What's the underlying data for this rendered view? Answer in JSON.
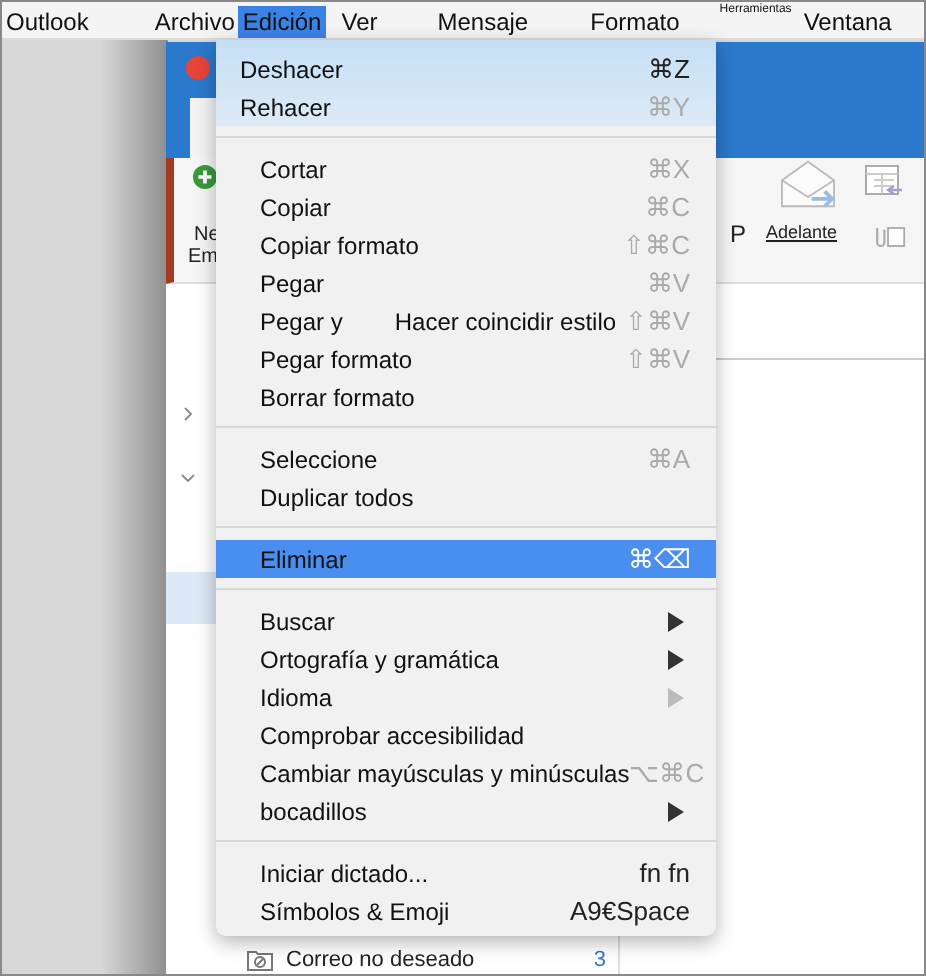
{
  "menu_bar": [
    {
      "label": "Outlook",
      "selected": false
    },
    {
      "label": "Archivo",
      "selected": false
    },
    {
      "label": "Edición",
      "selected": true
    },
    {
      "label": "Ver",
      "selected": false
    },
    {
      "label": "Mensaje",
      "selected": false
    },
    {
      "label": "Formato",
      "selected": false
    },
    {
      "label": "Herramientas",
      "selected": false
    },
    {
      "label": "Ventana",
      "selected": false
    }
  ],
  "window": {
    "toolbar": {
      "new_label_line_1": "Ne",
      "new_label_line_2": "Em",
      "reply_label": "P",
      "forward_label": "Adelante"
    },
    "folder": {
      "name": "Correo no deseado",
      "count": "3"
    }
  },
  "edit_menu": {
    "sections": [
      {
        "items": [
          {
            "label": "Deshacer",
            "shortcut": "⌘Z",
            "shortcut_dim": false,
            "submenu": false,
            "selected": false
          },
          {
            "label": "Rehacer",
            "shortcut": "⌘Y",
            "shortcut_dim": true,
            "submenu": false,
            "selected": false
          }
        ]
      },
      {
        "items": [
          {
            "label": "Cortar",
            "shortcut": "⌘X",
            "shortcut_dim": true,
            "submenu": false,
            "selected": false
          },
          {
            "label": "Copiar",
            "shortcut": "⌘C",
            "shortcut_dim": true,
            "submenu": false,
            "selected": false
          },
          {
            "label": "Copiar formato",
            "shortcut": "⇧⌘C",
            "shortcut_dim": true,
            "submenu": false,
            "selected": false
          },
          {
            "label": "Pegar",
            "shortcut": "⌘V",
            "shortcut_dim": true,
            "submenu": false,
            "selected": false
          },
          {
            "label": "Pegar y",
            "label_2": "Hacer coincidir estilo",
            "shortcut": "⇧⌘V",
            "shortcut_dim": true,
            "submenu": false,
            "selected": false
          },
          {
            "label": "Pegar formato",
            "shortcut": "⇧⌘V",
            "shortcut_dim": true,
            "submenu": false,
            "selected": false
          },
          {
            "label": "Borrar formato",
            "submenu": false,
            "selected": false
          }
        ]
      },
      {
        "items": [
          {
            "label": "Seleccione",
            "shortcut": "⌘A",
            "shortcut_dim": true,
            "submenu": false,
            "selected": false
          },
          {
            "label": "Duplicar todos",
            "submenu": false,
            "selected": false
          }
        ]
      },
      {
        "items": [
          {
            "label": "Eliminar",
            "shortcut": "⌘⌫",
            "shortcut_dim": false,
            "submenu": false,
            "selected": true
          }
        ]
      },
      {
        "items": [
          {
            "label": "Buscar",
            "submenu": true,
            "submenu_enabled": true,
            "selected": false
          },
          {
            "label": "Ortografía y gramática",
            "submenu": true,
            "submenu_enabled": true,
            "selected": false
          },
          {
            "label": "Idioma",
            "submenu": true,
            "submenu_enabled": false,
            "selected": false
          },
          {
            "label": "Comprobar accesibilidad",
            "submenu": false,
            "selected": false
          },
          {
            "label": "Cambiar mayúsculas y minúsculas",
            "shortcut": "⌥⌘C",
            "shortcut_dim": true,
            "submenu": false,
            "selected": false
          },
          {
            "label": "bocadillos",
            "submenu": true,
            "submenu_enabled": true,
            "selected": false
          }
        ]
      },
      {
        "items": [
          {
            "label": "Iniciar dictado...",
            "shortcut": "fn fn",
            "shortcut_dim": false,
            "submenu": false,
            "selected": false
          },
          {
            "label": "Símbolos & Emoji",
            "shortcut": "A9€Space",
            "shortcut_dim": false,
            "submenu": false,
            "selected": false
          }
        ]
      }
    ]
  }
}
